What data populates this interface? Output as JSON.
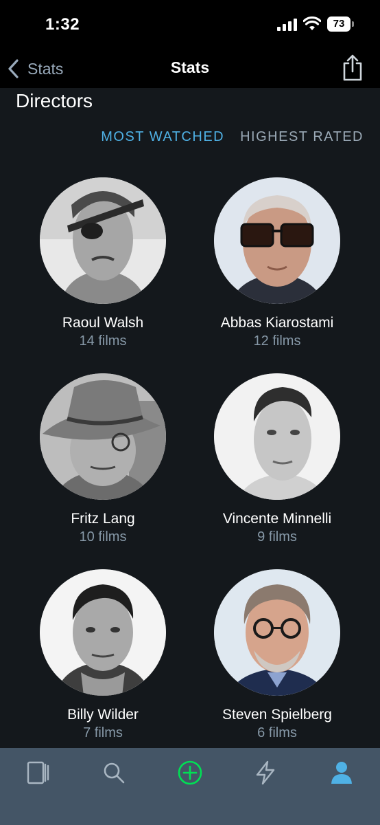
{
  "status_bar": {
    "time": "1:32",
    "battery": "73"
  },
  "nav": {
    "back_label": "Stats",
    "title": "Stats"
  },
  "section": {
    "title": "Directors"
  },
  "tabs": [
    {
      "label": "MOST WATCHED",
      "active": true
    },
    {
      "label": "HIGHEST RATED",
      "active": false
    }
  ],
  "directors": [
    {
      "name": "Raoul Walsh",
      "count": "14 films"
    },
    {
      "name": "Abbas Kiarostami",
      "count": "12 films"
    },
    {
      "name": "Fritz Lang",
      "count": "10 films"
    },
    {
      "name": "Vincente Minnelli",
      "count": "9 films"
    },
    {
      "name": "Billy Wilder",
      "count": "7 films"
    },
    {
      "name": "Steven Spielberg",
      "count": "6 films"
    }
  ],
  "tab_bar": {
    "items": [
      "films-icon",
      "search-icon",
      "add-icon",
      "activity-icon",
      "profile-icon"
    ],
    "active": "profile-icon"
  },
  "colors": {
    "background": "#14181c",
    "accent_blue": "#4fb1e5",
    "accent_green": "#00e054",
    "tab_bar": "#445566"
  }
}
